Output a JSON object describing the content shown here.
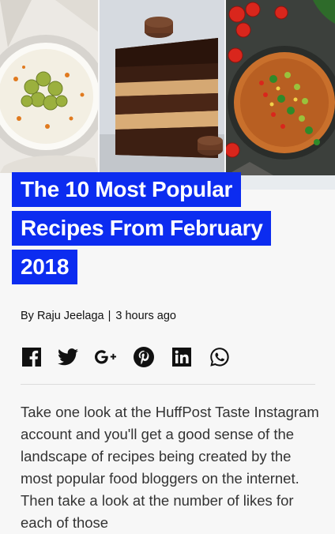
{
  "article": {
    "headline_lines": [
      "The 10 Most Popular",
      "Recipes From February",
      "2018"
    ],
    "author": "Raju Jeelaga",
    "separator": "|",
    "time": "3 hours ago",
    "byline_prefix": "By",
    "body": "Take one look at the HuffPost Taste Instagram account and you'll get a good sense of the landscape of recipes being created by the most popular food bloggers on the internet. Then take a look at the number of likes for each of those"
  },
  "share_icons": [
    "facebook-icon",
    "twitter-icon",
    "google-plus-icon",
    "pinterest-icon",
    "linkedin-icon",
    "whatsapp-icon"
  ],
  "colors": {
    "headline_bg": "#0c2cf0",
    "headline_text": "#ffffff"
  }
}
